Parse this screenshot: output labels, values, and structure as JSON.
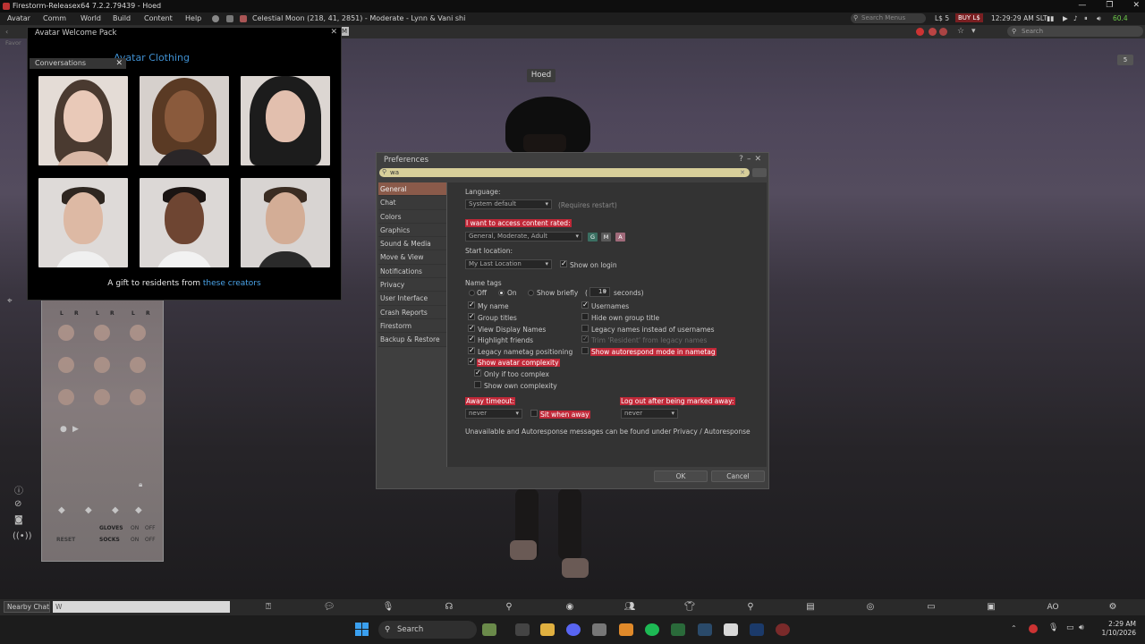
{
  "window": {
    "title": "Firestorm-Releasex64 7.2.2.79439 - Hoed",
    "controls": [
      "—",
      "❐",
      "✕"
    ]
  },
  "menubar": {
    "items": [
      "Avatar",
      "Comm",
      "World",
      "Build",
      "Content",
      "Help"
    ],
    "location": "Celestial Moon (218, 41, 2851) - Moderate - Lynn & Vani shi",
    "search_placeholder": "Search Menus",
    "balance": "L$ 5",
    "buy": "BUY L$",
    "time": "12:29:29 AM SLT",
    "fps": "60.4"
  },
  "navbar": {
    "search_placeholder": "Search",
    "favorites": "Favor",
    "m_label": "M"
  },
  "welcome_pack": {
    "title": "Avatar Welcome Pack",
    "ghost_heading": "Avatar Clothing",
    "conversations": "Conversations",
    "gift_text": "A gift to residents from",
    "gift_link": "these creators"
  },
  "scene": {
    "name_tag": "Hoed",
    "corner_badge": "5"
  },
  "hud": {
    "lr": [
      "L",
      "R",
      "L",
      "R",
      "L",
      "R"
    ],
    "gloves_label": "GLOVES",
    "socks_label": "SOCKS",
    "reset_label": "RESET",
    "on": "ON",
    "off": "OFF"
  },
  "preferences": {
    "title": "Preferences",
    "search_value": "wa",
    "categories": [
      "General",
      "Chat",
      "Colors",
      "Graphics",
      "Sound & Media",
      "Move & View",
      "Notifications",
      "Privacy",
      "User Interface",
      "Crash Reports",
      "Firestorm",
      "Backup & Restore"
    ],
    "active_category": "General",
    "language_label": "Language:",
    "language_value": "System default",
    "requires_restart": "(Requires restart)",
    "content_rated_label": "I want to access content rated:",
    "content_rated_value": "General, Moderate, Adult",
    "maturity_badges": [
      "G",
      "M",
      "A"
    ],
    "start_location_label": "Start location:",
    "start_location_value": "My Last Location",
    "show_on_login": "Show on login",
    "name_tags_label": "Name tags",
    "name_tag_options": [
      "Off",
      "On",
      "Show briefly"
    ],
    "briefly_seconds": "10",
    "seconds_label": "seconds)",
    "paren_open": "(",
    "left_checks": [
      {
        "label": "My name",
        "checked": true
      },
      {
        "label": "Group titles",
        "checked": true
      },
      {
        "label": "View Display Names",
        "checked": true
      },
      {
        "label": "Highlight friends",
        "checked": true
      },
      {
        "label": "Legacy nametag positioning",
        "checked": true
      },
      {
        "label": "Show avatar complexity",
        "checked": true
      }
    ],
    "sub_checks": [
      {
        "label": "Only if too complex",
        "checked": true
      },
      {
        "label": "Show own complexity",
        "checked": false
      }
    ],
    "right_checks": [
      {
        "label": "Usernames",
        "checked": true
      },
      {
        "label": "Hide own group title",
        "checked": false
      },
      {
        "label": "Legacy names instead of usernames",
        "checked": false
      },
      {
        "label": "Trim 'Resident' from legacy names",
        "checked": true
      },
      {
        "label": "Show autorespond mode in nametag",
        "checked": false
      }
    ],
    "away_timeout_label": "Away timeout:",
    "away_timeout_value": "never",
    "sit_when_away": "Sit when away",
    "logout_label": "Log out after being marked away:",
    "logout_value": "never",
    "footer_note": "Unavailable and Autoresponse messages can be found under Privacy / Autoresponse",
    "ok": "OK",
    "cancel": "Cancel"
  },
  "chatbar": {
    "nearby": "Nearby Chat",
    "input_value": "W"
  },
  "taskbar": {
    "search": "Search",
    "time": "2:29 AM",
    "date": "1/10/2026"
  }
}
